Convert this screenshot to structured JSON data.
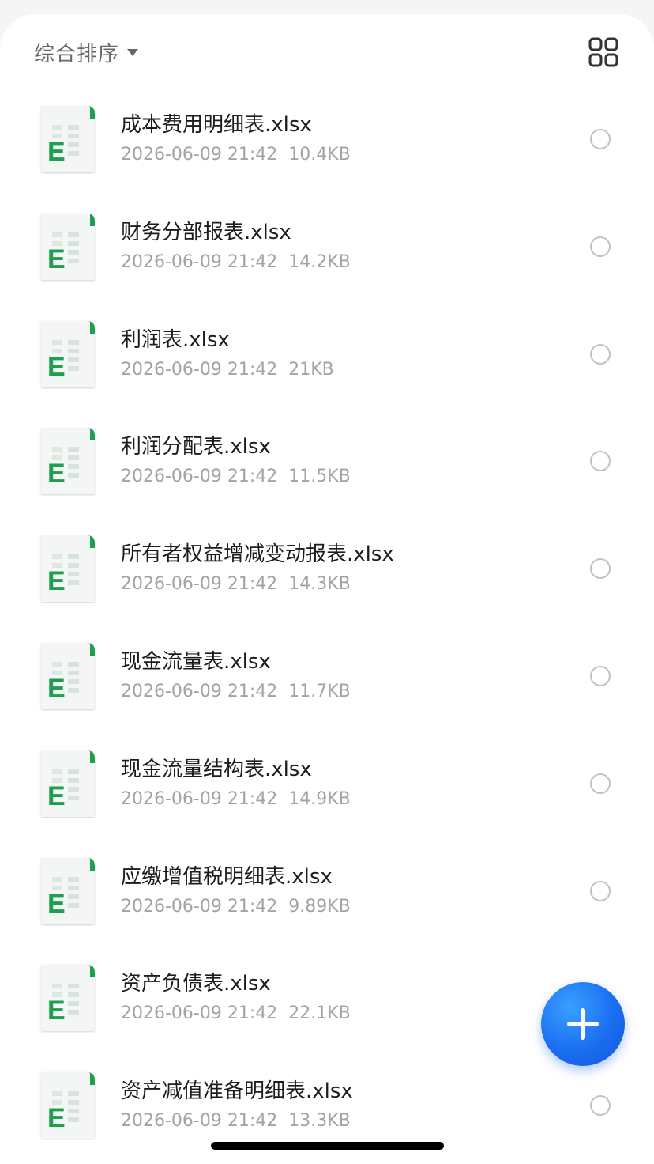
{
  "toolbar": {
    "sort_label": "综合排序",
    "sort_icon": "caret-down-icon",
    "view_toggle_icon": "grid-view-icon"
  },
  "colors": {
    "excel_green": "#1e9e4f",
    "fab_blue": "#1a6ef0",
    "meta_gray": "#a3a3a3"
  },
  "files": [
    {
      "name": "成本费用明细表.xlsx",
      "date": "2026-06-09 21:42",
      "size": "10.4KB",
      "icon": "excel-file-icon"
    },
    {
      "name": "财务分部报表.xlsx",
      "date": "2026-06-09 21:42",
      "size": "14.2KB",
      "icon": "excel-file-icon"
    },
    {
      "name": "利润表.xlsx",
      "date": "2026-06-09 21:42",
      "size": "21KB",
      "icon": "excel-file-icon"
    },
    {
      "name": "利润分配表.xlsx",
      "date": "2026-06-09 21:42",
      "size": "11.5KB",
      "icon": "excel-file-icon"
    },
    {
      "name": "所有者权益增减变动报表.xlsx",
      "date": "2026-06-09 21:42",
      "size": "14.3KB",
      "icon": "excel-file-icon"
    },
    {
      "name": "现金流量表.xlsx",
      "date": "2026-06-09 21:42",
      "size": "11.7KB",
      "icon": "excel-file-icon"
    },
    {
      "name": "现金流量结构表.xlsx",
      "date": "2026-06-09 21:42",
      "size": "14.9KB",
      "icon": "excel-file-icon"
    },
    {
      "name": "应缴增值税明细表.xlsx",
      "date": "2026-06-09 21:42",
      "size": "9.89KB",
      "icon": "excel-file-icon"
    },
    {
      "name": "资产负债表.xlsx",
      "date": "2026-06-09 21:42",
      "size": "22.1KB",
      "icon": "excel-file-icon"
    },
    {
      "name": "资产减值准备明细表.xlsx",
      "date": "2026-06-09 21:42",
      "size": "13.3KB",
      "icon": "excel-file-icon"
    }
  ],
  "fab": {
    "icon": "plus-icon"
  }
}
